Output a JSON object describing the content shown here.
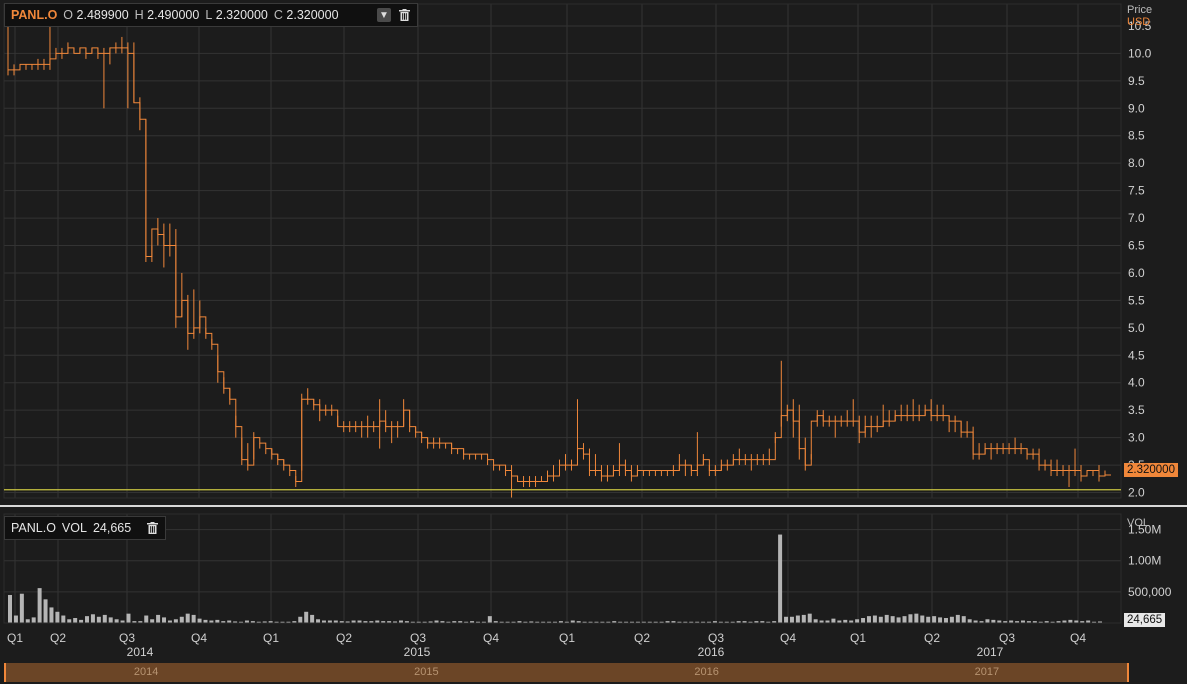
{
  "price_legend": {
    "symbol": "PANL.O",
    "open_label": "O",
    "open": "2.489900",
    "high_label": "H",
    "high": "2.490000",
    "low_label": "L",
    "low": "2.320000",
    "close_label": "C",
    "close": "2.320000"
  },
  "volume_legend": {
    "symbol": "PANL.O",
    "label": "VOL",
    "value": "24,665"
  },
  "price_axis": {
    "title": "Price",
    "currency": "USD",
    "last_price": "2.320000"
  },
  "volume_axis": {
    "title": "VOL",
    "last_volume": "24,665"
  },
  "navigator": {
    "years": [
      "2014",
      "2015",
      "2016",
      "2017"
    ]
  },
  "colors": {
    "price_line": "#f0873a",
    "reference_line": "#c8c341",
    "volume_bar": "#b5b5b5",
    "grid": "#333333",
    "background": "#1c1c1c"
  },
  "chart_data": [
    {
      "type": "line",
      "subtype": "ohlc-step",
      "title": "",
      "ylabel": "Price USD",
      "ylim": [
        1.9,
        10.9
      ],
      "yticks": [
        2.0,
        2.5,
        3.0,
        3.5,
        4.0,
        4.5,
        5.0,
        5.5,
        6.0,
        6.5,
        7.0,
        7.5,
        8.0,
        8.5,
        9.0,
        9.5,
        10.0,
        10.5
      ],
      "ytick_labels": [
        "2.0",
        "2.5",
        "3.0",
        "3.5",
        "4.0",
        "4.5",
        "5.0",
        "5.5",
        "6.0",
        "6.5",
        "7.0",
        "7.5",
        "8.0",
        "8.5",
        "9.0",
        "9.5",
        "10.0",
        "10.5"
      ],
      "x_quarter_labels": [
        "Q1",
        "Q2",
        "Q3",
        "Q4",
        "Q1",
        "Q2",
        "Q3",
        "Q4",
        "Q1",
        "Q2",
        "Q3",
        "Q4",
        "Q1",
        "Q2",
        "Q3",
        "Q4"
      ],
      "x_year_labels": [
        "2014",
        "2015",
        "2016",
        "2017"
      ],
      "reference_line": 2.05,
      "x": [
        0,
        1,
        2,
        3,
        4,
        5,
        6,
        7,
        8,
        9,
        10,
        11,
        12,
        13,
        14,
        15,
        16,
        17,
        18,
        19,
        20,
        21,
        22,
        23,
        24,
        25,
        26,
        27,
        28,
        29,
        30,
        31,
        32,
        33,
        34,
        35,
        36,
        37,
        38,
        39,
        40,
        41,
        42,
        43,
        44,
        45,
        46,
        47,
        48,
        49,
        50,
        51,
        52,
        53,
        54,
        55,
        56,
        57,
        58,
        59,
        60,
        61,
        62,
        63,
        64,
        65,
        66,
        67,
        68,
        69,
        70,
        71,
        72,
        73,
        74,
        75,
        76,
        77,
        78,
        79,
        80,
        81,
        82,
        83,
        84,
        85,
        86,
        87,
        88,
        89,
        90,
        91,
        92,
        93,
        94,
        95,
        96,
        97,
        98,
        99,
        100,
        101,
        102,
        103,
        104,
        105,
        106,
        107,
        108,
        109,
        110,
        111,
        112,
        113,
        114,
        115,
        116,
        117,
        118,
        119,
        120,
        121,
        122,
        123,
        124,
        125,
        126,
        127,
        128,
        129,
        130,
        131,
        132,
        133,
        134,
        135,
        136,
        137,
        138,
        139,
        140,
        141,
        142,
        143,
        144,
        145,
        146,
        147,
        148,
        149,
        150,
        151,
        152,
        153,
        154,
        155,
        156,
        157,
        158,
        159,
        160,
        161,
        162,
        163,
        164,
        165,
        166,
        167,
        168,
        169,
        170,
        171,
        172,
        173,
        174,
        175,
        176,
        177,
        178,
        179,
        180,
        181,
        182,
        183,
        184,
        185,
        186,
        187,
        188,
        189,
        190,
        191
      ],
      "high": [
        10.8,
        9.8,
        9.8,
        9.8,
        9.8,
        9.9,
        9.9,
        10.5,
        10.1,
        10.1,
        10.2,
        10.1,
        10.1,
        10.1,
        10.1,
        10.1,
        10.1,
        10.1,
        10.2,
        10.3,
        10.2,
        10.2,
        9.2,
        8.8,
        6.5,
        7.0,
        6.9,
        6.9,
        6.8,
        6.0,
        5.6,
        5.7,
        5.5,
        5.0,
        4.8,
        4.5,
        4.1,
        3.9,
        3.4,
        3.0,
        2.9,
        3.1,
        2.9,
        2.8,
        2.8,
        2.7,
        2.6,
        2.4,
        2.3,
        3.8,
        3.9,
        3.7,
        3.7,
        3.6,
        3.6,
        3.4,
        3.3,
        3.3,
        3.3,
        3.3,
        3.4,
        3.3,
        3.7,
        3.5,
        3.3,
        3.3,
        3.7,
        3.5,
        3.2,
        3.1,
        3.0,
        3.0,
        3.0,
        2.9,
        2.9,
        2.8,
        2.8,
        2.7,
        2.7,
        2.7,
        2.6,
        2.5,
        2.5,
        2.5,
        2.5,
        2.3,
        2.3,
        2.3,
        2.3,
        2.3,
        2.4,
        2.5,
        2.6,
        2.7,
        2.6,
        3.7,
        2.9,
        2.8,
        2.7,
        2.5,
        2.5,
        2.5,
        2.9,
        2.6,
        2.5,
        2.5,
        2.4,
        2.4,
        2.4,
        2.4,
        2.4,
        2.5,
        2.7,
        2.6,
        2.5,
        3.1,
        2.7,
        2.5,
        2.5,
        2.6,
        2.6,
        2.7,
        2.8,
        2.7,
        2.7,
        2.7,
        2.7,
        2.8,
        3.1,
        4.4,
        3.6,
        3.7,
        3.6,
        3.0,
        2.7,
        3.5,
        3.5,
        3.4,
        3.4,
        3.4,
        3.5,
        3.7,
        3.4,
        3.4,
        3.4,
        3.4,
        3.6,
        3.5,
        3.5,
        3.6,
        3.6,
        3.7,
        3.6,
        3.6,
        3.7,
        3.6,
        3.6,
        3.4,
        3.4,
        3.3,
        3.3,
        3.2,
        2.9,
        2.9,
        2.9,
        2.9,
        2.9,
        2.9,
        3.0,
        2.9,
        2.8,
        2.8,
        2.8,
        2.6,
        2.6,
        2.6,
        2.5,
        2.5,
        2.8,
        2.5,
        2.4,
        2.4,
        2.5,
        2.4
      ],
      "low": [
        9.6,
        9.6,
        9.7,
        9.7,
        9.7,
        9.7,
        9.7,
        9.7,
        9.9,
        9.9,
        10.0,
        10.0,
        10.0,
        9.9,
        10.0,
        9.9,
        9.0,
        9.8,
        10.0,
        10.0,
        9.0,
        9.1,
        8.6,
        6.2,
        6.2,
        6.5,
        6.1,
        6.3,
        5.0,
        5.2,
        4.6,
        4.8,
        4.9,
        4.8,
        4.6,
        4.0,
        3.8,
        3.6,
        3.0,
        2.5,
        2.4,
        2.6,
        2.8,
        2.7,
        2.6,
        2.5,
        2.4,
        2.3,
        2.1,
        2.4,
        3.6,
        3.5,
        3.3,
        3.4,
        3.4,
        3.2,
        3.1,
        3.1,
        3.1,
        3.0,
        3.0,
        3.1,
        2.8,
        3.1,
        2.9,
        3.0,
        3.2,
        3.1,
        3.0,
        2.9,
        2.8,
        2.8,
        2.8,
        2.8,
        2.7,
        2.7,
        2.6,
        2.6,
        2.6,
        2.6,
        2.5,
        2.4,
        2.4,
        2.3,
        1.9,
        2.2,
        2.1,
        2.1,
        2.1,
        2.2,
        2.2,
        2.2,
        2.4,
        2.4,
        2.4,
        2.5,
        2.6,
        2.3,
        2.3,
        2.2,
        2.2,
        2.3,
        2.3,
        2.3,
        2.2,
        2.3,
        2.3,
        2.3,
        2.3,
        2.3,
        2.3,
        2.3,
        2.4,
        2.3,
        2.3,
        2.3,
        2.5,
        2.3,
        2.3,
        2.4,
        2.4,
        2.5,
        2.5,
        2.5,
        2.4,
        2.5,
        2.5,
        2.5,
        2.9,
        3.2,
        3.3,
        3.0,
        2.6,
        2.4,
        2.6,
        3.2,
        3.2,
        3.2,
        3.0,
        3.2,
        3.2,
        3.2,
        2.9,
        3.0,
        3.0,
        3.1,
        3.2,
        3.2,
        3.3,
        3.3,
        3.3,
        3.3,
        3.3,
        3.4,
        3.3,
        3.3,
        3.3,
        3.1,
        3.1,
        3.0,
        3.0,
        2.6,
        2.6,
        2.7,
        2.6,
        2.7,
        2.7,
        2.7,
        2.7,
        2.7,
        2.6,
        2.6,
        2.4,
        2.4,
        2.3,
        2.3,
        2.3,
        2.1,
        2.3,
        2.2,
        2.3,
        2.3,
        2.2,
        2.3
      ],
      "close": [
        9.7,
        9.7,
        9.8,
        9.8,
        9.8,
        9.8,
        9.8,
        9.9,
        10.0,
        10.0,
        10.1,
        10.0,
        10.1,
        10.0,
        10.1,
        10.0,
        10.0,
        10.1,
        10.1,
        10.1,
        10.0,
        9.1,
        8.8,
        6.3,
        6.8,
        6.7,
        6.5,
        6.5,
        5.2,
        5.5,
        4.9,
        5.0,
        5.2,
        4.9,
        4.7,
        4.2,
        3.9,
        3.7,
        3.2,
        2.6,
        2.5,
        3.0,
        2.9,
        2.8,
        2.7,
        2.6,
        2.5,
        2.4,
        2.2,
        3.7,
        3.7,
        3.6,
        3.5,
        3.5,
        3.5,
        3.2,
        3.2,
        3.2,
        3.2,
        3.2,
        3.2,
        3.2,
        3.3,
        3.2,
        3.2,
        3.2,
        3.5,
        3.2,
        3.1,
        3.0,
        2.9,
        2.9,
        2.9,
        2.9,
        2.8,
        2.8,
        2.7,
        2.7,
        2.7,
        2.7,
        2.6,
        2.5,
        2.5,
        2.4,
        2.3,
        2.2,
        2.2,
        2.2,
        2.2,
        2.2,
        2.3,
        2.3,
        2.5,
        2.5,
        2.5,
        2.8,
        2.7,
        2.4,
        2.4,
        2.3,
        2.3,
        2.4,
        2.5,
        2.4,
        2.3,
        2.4,
        2.4,
        2.4,
        2.4,
        2.4,
        2.4,
        2.4,
        2.5,
        2.5,
        2.4,
        2.5,
        2.6,
        2.4,
        2.4,
        2.5,
        2.5,
        2.6,
        2.6,
        2.6,
        2.6,
        2.6,
        2.6,
        2.6,
        3.0,
        3.4,
        3.5,
        3.3,
        2.8,
        2.5,
        3.3,
        3.4,
        3.3,
        3.3,
        3.3,
        3.3,
        3.3,
        3.3,
        3.1,
        3.2,
        3.2,
        3.2,
        3.3,
        3.3,
        3.4,
        3.4,
        3.4,
        3.4,
        3.4,
        3.5,
        3.4,
        3.4,
        3.4,
        3.3,
        3.3,
        3.1,
        3.1,
        2.7,
        2.7,
        2.8,
        2.8,
        2.8,
        2.8,
        2.8,
        2.8,
        2.8,
        2.7,
        2.7,
        2.5,
        2.5,
        2.4,
        2.4,
        2.4,
        2.4,
        2.4,
        2.3,
        2.4,
        2.4,
        2.3,
        2.32
      ]
    },
    {
      "type": "bar",
      "title": "",
      "ylabel": "VOL",
      "ylim": [
        0,
        1750000
      ],
      "yticks": [
        500000,
        1000000,
        1500000
      ],
      "ytick_labels": [
        "500,000",
        "1.00M",
        "1.50M"
      ],
      "values": [
        450000,
        120000,
        470000,
        60000,
        90000,
        560000,
        380000,
        250000,
        180000,
        120000,
        60000,
        80000,
        50000,
        110000,
        140000,
        100000,
        130000,
        90000,
        60000,
        40000,
        150000,
        30000,
        30000,
        120000,
        60000,
        130000,
        90000,
        40000,
        60000,
        100000,
        150000,
        130000,
        70000,
        50000,
        40000,
        50000,
        30000,
        40000,
        25000,
        20000,
        40000,
        30000,
        20000,
        25000,
        30000,
        20000,
        20000,
        20000,
        30000,
        100000,
        180000,
        130000,
        60000,
        40000,
        40000,
        40000,
        30000,
        25000,
        40000,
        40000,
        30000,
        30000,
        40000,
        30000,
        30000,
        25000,
        40000,
        30000,
        20000,
        20000,
        20000,
        25000,
        40000,
        30000,
        20000,
        30000,
        30000,
        20000,
        30000,
        20000,
        20000,
        110000,
        30000,
        20000,
        20000,
        20000,
        30000,
        20000,
        25000,
        20000,
        20000,
        20000,
        20000,
        30000,
        20000,
        40000,
        30000,
        20000,
        20000,
        20000,
        20000,
        20000,
        30000,
        20000,
        20000,
        20000,
        20000,
        20000,
        20000,
        20000,
        20000,
        30000,
        30000,
        20000,
        20000,
        20000,
        20000,
        20000,
        20000,
        30000,
        20000,
        20000,
        20000,
        30000,
        30000,
        20000,
        30000,
        30000,
        20000,
        30000,
        1420000,
        100000,
        100000,
        120000,
        130000,
        150000,
        60000,
        40000,
        40000,
        70000,
        40000,
        50000,
        40000,
        60000,
        80000,
        110000,
        120000,
        100000,
        130000,
        110000,
        90000,
        110000,
        140000,
        150000,
        120000,
        100000,
        110000,
        90000,
        80000,
        100000,
        130000,
        110000,
        60000,
        40000,
        30000,
        60000,
        50000,
        40000,
        30000,
        40000,
        30000,
        40000,
        30000,
        30000,
        20000,
        30000,
        20000,
        30000,
        40000,
        50000,
        40000,
        30000,
        40000,
        20000,
        24665
      ]
    }
  ]
}
